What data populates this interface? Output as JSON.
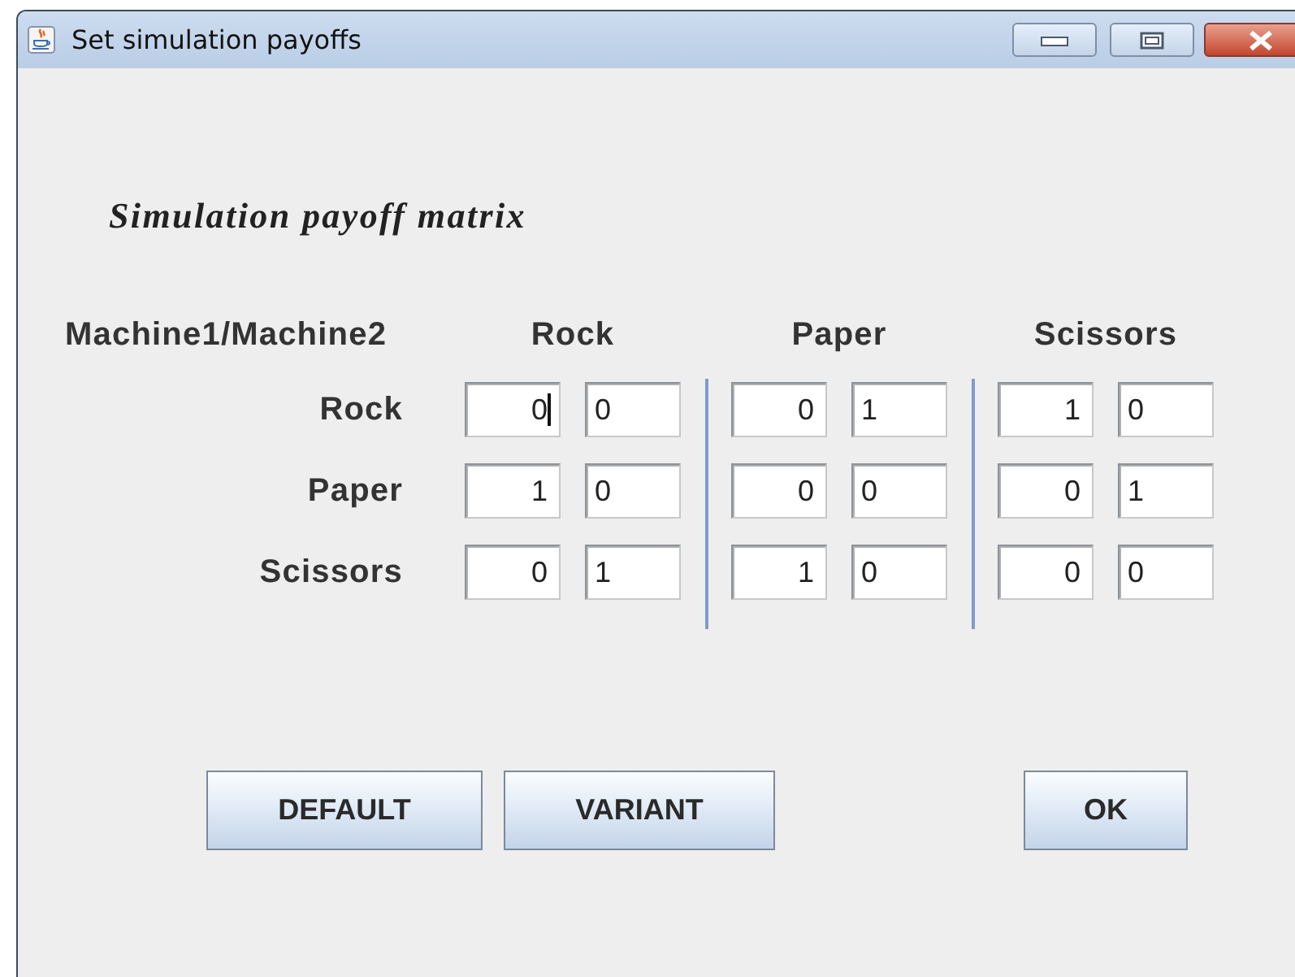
{
  "window": {
    "title": "Set simulation payoffs"
  },
  "heading": "Simulation payoff matrix",
  "corner_label": "Machine1/Machine2",
  "columns": [
    "Rock",
    "Paper",
    "Scissors"
  ],
  "rows": [
    {
      "label": "Rock",
      "fields": [
        {
          "value": "0",
          "focused": true
        },
        {
          "value": "0",
          "focused": false
        },
        {
          "value": "0",
          "focused": false
        },
        {
          "value": "1",
          "focused": false
        },
        {
          "value": "1",
          "focused": false
        },
        {
          "value": "0",
          "focused": false
        }
      ]
    },
    {
      "label": "Paper",
      "fields": [
        {
          "value": "1",
          "focused": false
        },
        {
          "value": "0",
          "focused": false
        },
        {
          "value": "0",
          "focused": false
        },
        {
          "value": "0",
          "focused": false
        },
        {
          "value": "0",
          "focused": false
        },
        {
          "value": "1",
          "focused": false
        }
      ]
    },
    {
      "label": "Scissors",
      "fields": [
        {
          "value": "0",
          "focused": false
        },
        {
          "value": "1",
          "focused": false
        },
        {
          "value": "1",
          "focused": false
        },
        {
          "value": "0",
          "focused": false
        },
        {
          "value": "0",
          "focused": false
        },
        {
          "value": "0",
          "focused": false
        }
      ]
    }
  ],
  "buttons": [
    "DEFAULT",
    "VARIANT",
    "OK"
  ]
}
